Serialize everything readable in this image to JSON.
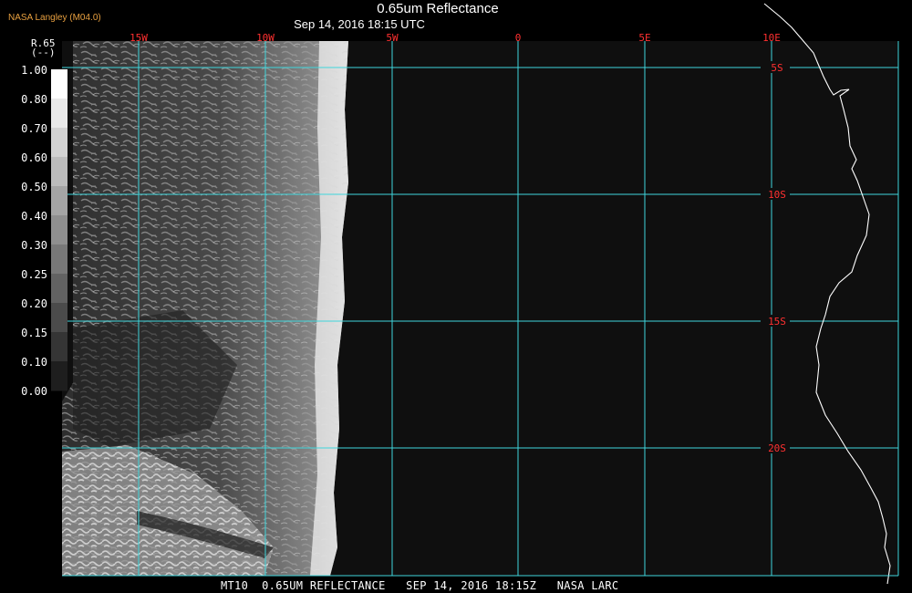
{
  "header": {
    "producer": "NASA Langley (M04.0)",
    "title": "0.65um Reflectance",
    "subtitle": "Sep 14, 2016 18:15 UTC"
  },
  "footer": {
    "caption": "MT10  0.65UM REFLECTANCE   SEP 14, 2016 18:15Z   NASA LARC"
  },
  "colorbar": {
    "label_line1": "R.65",
    "label_line2": "(--)",
    "ticks": [
      "1.00",
      "0.80",
      "0.70",
      "0.60",
      "0.50",
      "0.40",
      "0.30",
      "0.25",
      "0.20",
      "0.15",
      "0.10",
      "0.00"
    ]
  },
  "map": {
    "longitude_labels": [
      "15W",
      "10W",
      "5W",
      "0",
      "5E",
      "10E"
    ],
    "latitude_labels": [
      "5S",
      "10S",
      "15S",
      "20S"
    ],
    "colors": {
      "grid": "#3fd6dc",
      "lon_label": "#ff3030",
      "lat_label": "#ff3030",
      "coastline": "#ffffff",
      "no_data": "#0f0f0f"
    }
  }
}
